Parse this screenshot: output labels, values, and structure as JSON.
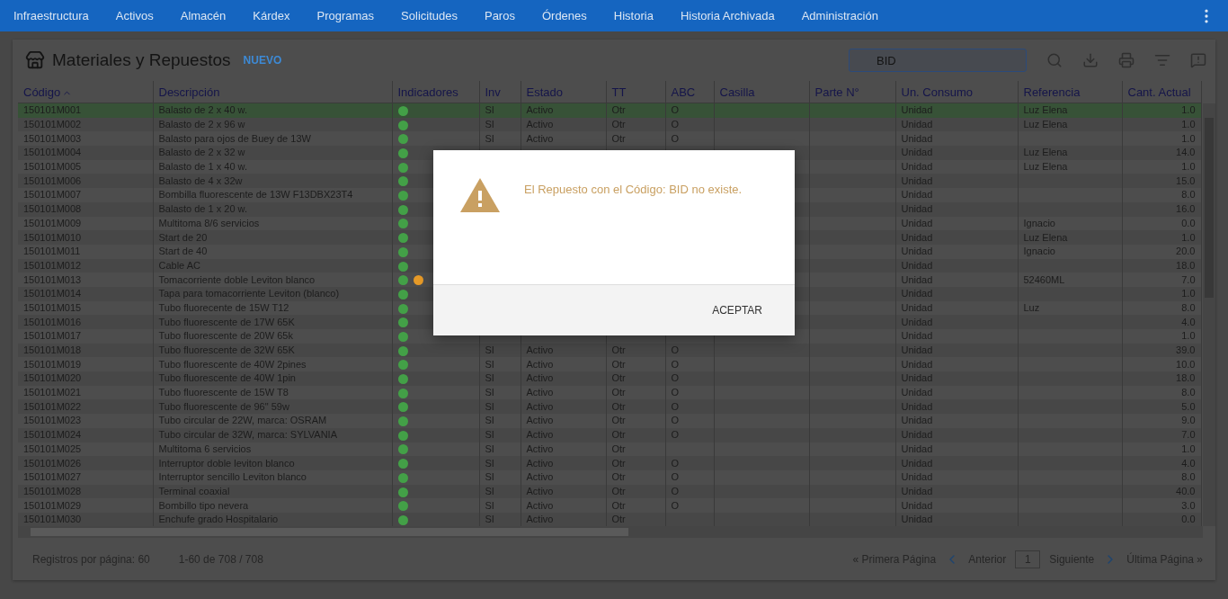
{
  "nav": {
    "items": [
      "Infraestructura",
      "Activos",
      "Almacén",
      "Kárdex",
      "Programas",
      "Solicitudes",
      "Paros",
      "Órdenes",
      "Historia",
      "Historia Archivada",
      "Administración"
    ]
  },
  "header": {
    "title": "Materiales y Repuestos",
    "new_link": "NUEVO",
    "search": {
      "value": "BID"
    }
  },
  "table": {
    "columns": [
      {
        "label": "Código",
        "sorted": true
      },
      {
        "label": "Descripción",
        "sorted": false
      },
      {
        "label": "Indicadores",
        "sorted": false
      },
      {
        "label": "Inv",
        "sorted": false
      },
      {
        "label": "Estado",
        "sorted": false
      },
      {
        "label": "TT",
        "sorted": false
      },
      {
        "label": "ABC",
        "sorted": false
      },
      {
        "label": "Casilla",
        "sorted": false
      },
      {
        "label": "Parte N°",
        "sorted": false
      },
      {
        "label": "Un. Consumo",
        "sorted": false
      },
      {
        "label": "Referencia",
        "sorted": false
      },
      {
        "label": "Cant. Actual",
        "sorted": false
      }
    ],
    "rows": [
      {
        "selected": true,
        "code": "150101M001",
        "description": "Balasto de 2 x 40 w.",
        "indicators": [
          {
            "color": "#43a047"
          }
        ],
        "inv": "SI",
        "status": "Activo",
        "tt": "Otr",
        "abc": "O",
        "unit": "Unidad",
        "reference": "Luz Elena",
        "quantity": "1.0"
      },
      {
        "selected": false,
        "code": "150101M002",
        "description": "Balasto de 2 x 96 w",
        "indicators": [
          {
            "color": "#43a047"
          }
        ],
        "inv": "SI",
        "status": "Activo",
        "tt": "Otr",
        "abc": "O",
        "unit": "Unidad",
        "reference": "Luz Elena",
        "quantity": "1.0"
      },
      {
        "selected": false,
        "code": "150101M003",
        "description": "Balasto para ojos de Buey de 13W",
        "indicators": [
          {
            "color": "#43a047"
          }
        ],
        "inv": "SI",
        "status": "Activo",
        "tt": "Otr",
        "abc": "O",
        "unit": "Unidad",
        "quantity": "1.0"
      },
      {
        "selected": false,
        "code": "150101M004",
        "description": "Balasto de 2 x 32 w",
        "indicators": [
          {
            "color": "#43a047"
          }
        ],
        "unit": "Unidad",
        "reference": "Luz Elena",
        "quantity": "14.0"
      },
      {
        "selected": false,
        "code": "150101M005",
        "description": "Balasto de 1 x 40 w.",
        "indicators": [
          {
            "color": "#43a047"
          }
        ],
        "unit": "Unidad",
        "reference": "Luz Elena",
        "quantity": "1.0"
      },
      {
        "selected": false,
        "code": "150101M006",
        "description": "Balasto de 4 x 32w",
        "indicators": [
          {
            "color": "#43a047"
          }
        ],
        "unit": "Unidad",
        "quantity": "15.0"
      },
      {
        "selected": false,
        "code": "150101M007",
        "description": "Bombilla fluorescente de 13W F13DBX23T4",
        "indicators": [
          {
            "color": "#43a047"
          }
        ],
        "unit": "Unidad",
        "quantity": "8.0"
      },
      {
        "selected": false,
        "code": "150101M008",
        "description": "Balasto de 1 x 20 w.",
        "indicators": [
          {
            "color": "#43a047"
          }
        ],
        "unit": "Unidad",
        "quantity": "16.0"
      },
      {
        "selected": false,
        "code": "150101M009",
        "description": "Multitoma 8/6 servicios",
        "indicators": [
          {
            "color": "#43a047"
          }
        ],
        "unit": "Unidad",
        "reference": "Ignacio",
        "quantity": "0.0"
      },
      {
        "selected": false,
        "code": "150101M010",
        "description": "Start de 20",
        "indicators": [
          {
            "color": "#43a047"
          }
        ],
        "unit": "Unidad",
        "reference": "Luz Elena",
        "quantity": "1.0"
      },
      {
        "selected": false,
        "code": "150101M011",
        "description": "Start de 40",
        "indicators": [
          {
            "color": "#43a047"
          }
        ],
        "unit": "Unidad",
        "reference": "Ignacio",
        "quantity": "20.0"
      },
      {
        "selected": false,
        "code": "150101M012",
        "description": "Cable AC",
        "indicators": [
          {
            "color": "#43a047"
          }
        ],
        "unit": "Unidad",
        "quantity": "18.0"
      },
      {
        "selected": false,
        "code": "150101M013",
        "description": "Tomacorriente doble Leviton blanco",
        "indicators": [
          {
            "color": "#43a047"
          },
          {
            "color": "#e69a28"
          }
        ],
        "unit": "Unidad",
        "reference": "52460ML",
        "quantity": "7.0"
      },
      {
        "selected": false,
        "code": "150101M014",
        "description": "Tapa para tomacorriente Leviton (blanco)",
        "indicators": [
          {
            "color": "#43a047"
          }
        ],
        "unit": "Unidad",
        "quantity": "1.0"
      },
      {
        "selected": false,
        "code": "150101M015",
        "description": "Tubo fluorecente de 15W T12",
        "indicators": [
          {
            "color": "#43a047"
          }
        ],
        "unit": "Unidad",
        "reference": "Luz",
        "quantity": "8.0"
      },
      {
        "selected": false,
        "code": "150101M016",
        "description": "Tubo fluorescente de 17W 65K",
        "indicators": [
          {
            "color": "#43a047"
          }
        ],
        "unit": "Unidad",
        "quantity": "4.0"
      },
      {
        "selected": false,
        "code": "150101M017",
        "description": "Tubo fluorescente de 20W 65k",
        "indicators": [
          {
            "color": "#43a047"
          }
        ],
        "unit": "Unidad",
        "quantity": "1.0"
      },
      {
        "selected": false,
        "code": "150101M018",
        "description": "Tubo fluorescente de 32W 65K",
        "indicators": [
          {
            "color": "#43a047"
          }
        ],
        "inv": "SI",
        "status": "Activo",
        "tt": "Otr",
        "abc": "O",
        "unit": "Unidad",
        "quantity": "39.0"
      },
      {
        "selected": false,
        "code": "150101M019",
        "description": "Tubo fluorescente de 40W 2pines",
        "indicators": [
          {
            "color": "#43a047"
          }
        ],
        "inv": "SI",
        "status": "Activo",
        "tt": "Otr",
        "abc": "O",
        "unit": "Unidad",
        "quantity": "10.0"
      },
      {
        "selected": false,
        "code": "150101M020",
        "description": "Tubo fluorescente de 40W 1pin",
        "indicators": [
          {
            "color": "#43a047"
          }
        ],
        "inv": "SI",
        "status": "Activo",
        "tt": "Otr",
        "abc": "O",
        "unit": "Unidad",
        "quantity": "18.0"
      },
      {
        "selected": false,
        "code": "150101M021",
        "description": "Tubo fluorescente de 15W T8",
        "indicators": [
          {
            "color": "#43a047"
          }
        ],
        "inv": "SI",
        "status": "Activo",
        "tt": "Otr",
        "abc": "O",
        "unit": "Unidad",
        "quantity": "8.0"
      },
      {
        "selected": false,
        "code": "150101M022",
        "description": "Tubo fluorescente de 96\" 59w",
        "indicators": [
          {
            "color": "#43a047"
          }
        ],
        "inv": "SI",
        "status": "Activo",
        "tt": "Otr",
        "abc": "O",
        "unit": "Unidad",
        "quantity": "5.0"
      },
      {
        "selected": false,
        "code": "150101M023",
        "description": "Tubo circular de 22W, marca: OSRAM",
        "indicators": [
          {
            "color": "#43a047"
          }
        ],
        "inv": "SI",
        "status": "Activo",
        "tt": "Otr",
        "abc": "O",
        "unit": "Unidad",
        "quantity": "9.0"
      },
      {
        "selected": false,
        "code": "150101M024",
        "description": "Tubo circular de 32W, marca: SYLVANIA",
        "indicators": [
          {
            "color": "#43a047"
          }
        ],
        "inv": "SI",
        "status": "Activo",
        "tt": "Otr",
        "abc": "O",
        "unit": "Unidad",
        "quantity": "7.0"
      },
      {
        "selected": false,
        "code": "150101M025",
        "description": "Multitoma 6 servicios",
        "indicators": [
          {
            "color": "#43a047"
          }
        ],
        "inv": "SI",
        "status": "Activo",
        "tt": "Otr",
        "unit": "Unidad",
        "quantity": "1.0"
      },
      {
        "selected": false,
        "code": "150101M026",
        "description": "Interruptor doble leviton blanco",
        "indicators": [
          {
            "color": "#43a047"
          }
        ],
        "inv": "SI",
        "status": "Activo",
        "tt": "Otr",
        "abc": "O",
        "unit": "Unidad",
        "quantity": "4.0"
      },
      {
        "selected": false,
        "code": "150101M027",
        "description": "Interruptor sencillo Leviton blanco",
        "indicators": [
          {
            "color": "#43a047"
          }
        ],
        "inv": "SI",
        "status": "Activo",
        "tt": "Otr",
        "abc": "O",
        "unit": "Unidad",
        "quantity": "8.0"
      },
      {
        "selected": false,
        "code": "150101M028",
        "description": "Terminal coaxial",
        "indicators": [
          {
            "color": "#43a047"
          }
        ],
        "inv": "SI",
        "status": "Activo",
        "tt": "Otr",
        "abc": "O",
        "unit": "Unidad",
        "quantity": "40.0"
      },
      {
        "selected": false,
        "code": "150101M029",
        "description": "Bombillo tipo nevera",
        "indicators": [
          {
            "color": "#43a047"
          }
        ],
        "inv": "SI",
        "status": "Activo",
        "tt": "Otr",
        "abc": "O",
        "unit": "Unidad",
        "quantity": "3.0"
      },
      {
        "selected": false,
        "code": "150101M030",
        "description": "Enchufe grado Hospitalario",
        "indicators": [
          {
            "color": "#43a047"
          }
        ],
        "inv": "SI",
        "status": "Activo",
        "tt": "Otr",
        "unit": "Unidad",
        "quantity": "0.0"
      }
    ]
  },
  "footer": {
    "per_page": "Registros por página: 60",
    "range": "1-60 de 708 / 708",
    "first": "« Primera Página",
    "prev": "Anterior",
    "page": "1",
    "next": "Siguiente",
    "last": "Última Página »"
  },
  "dialog": {
    "message": "El Repuesto con el Código: BID no existe.",
    "button": "ACEPTAR"
  }
}
